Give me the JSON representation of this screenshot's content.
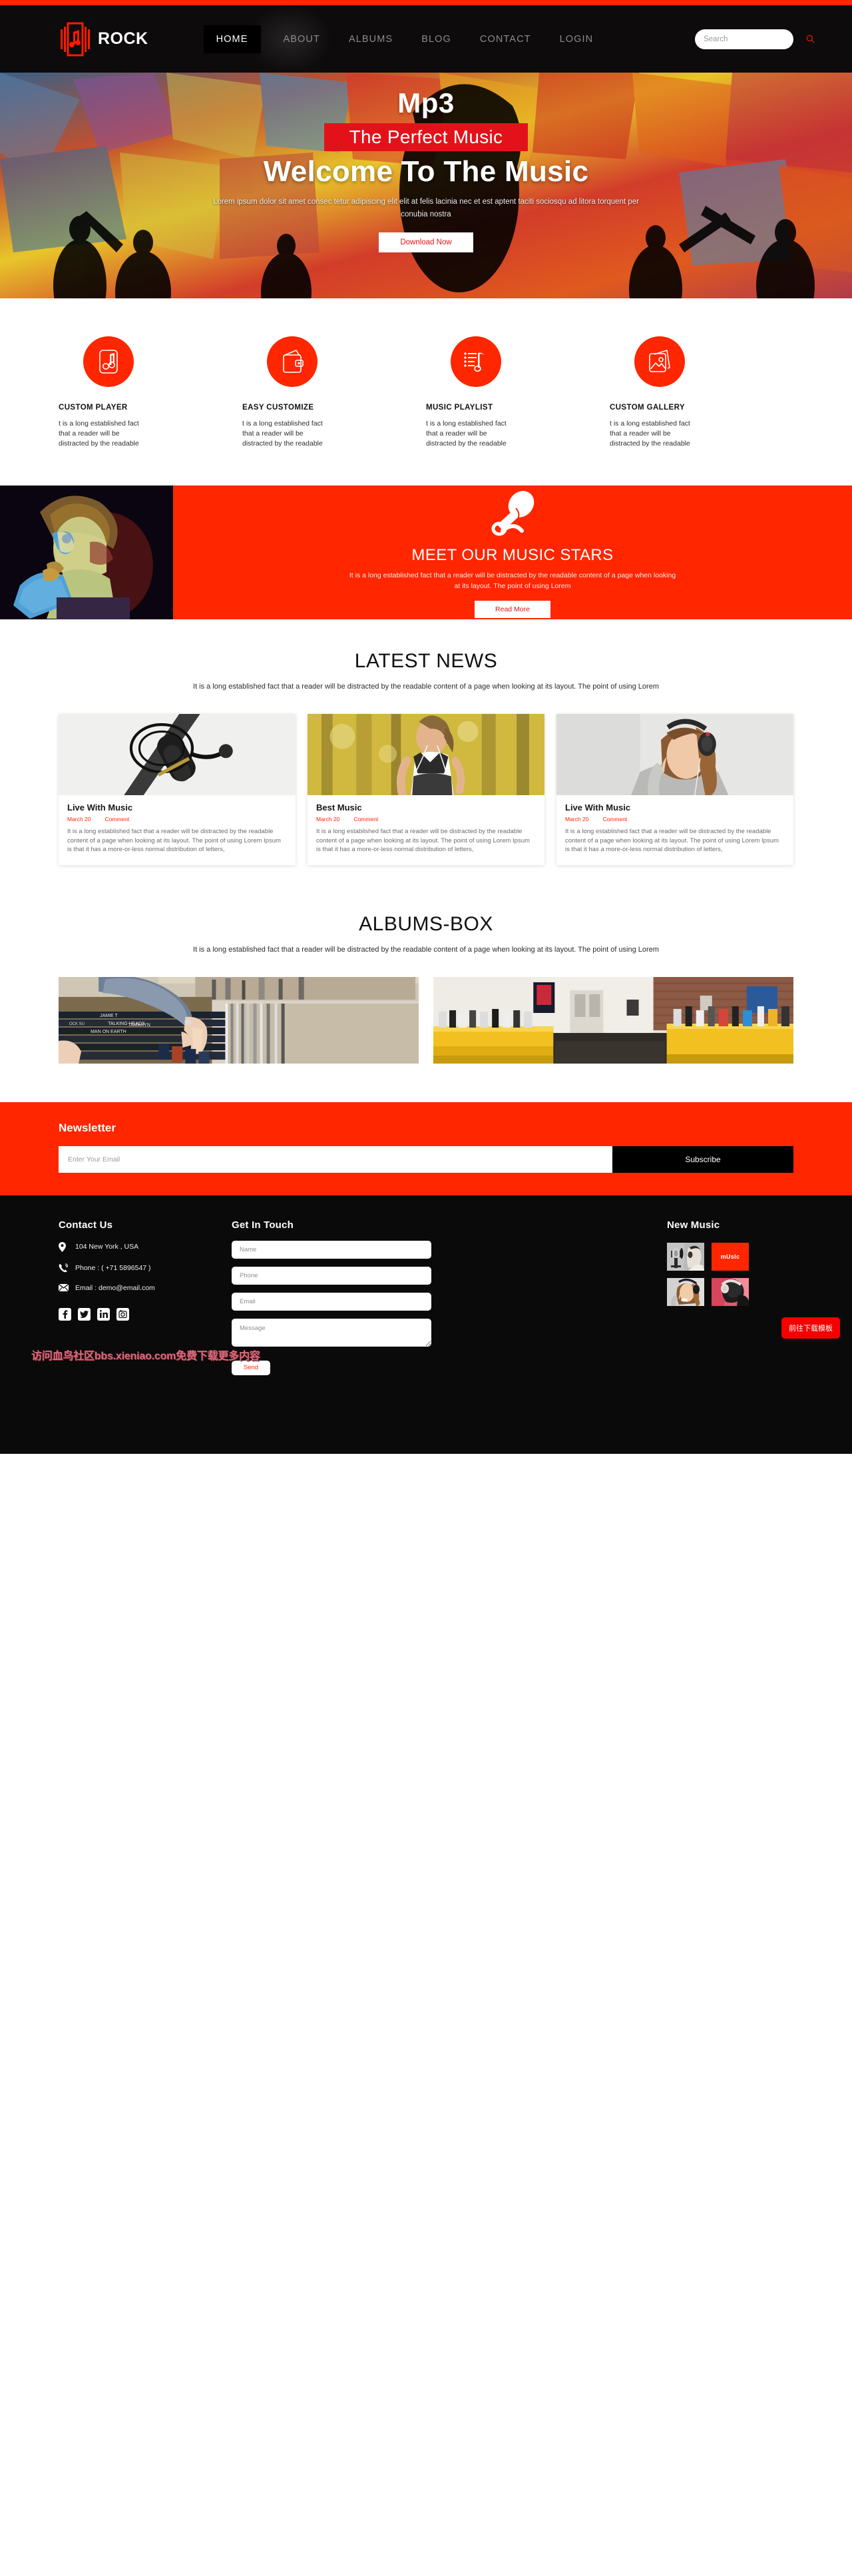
{
  "brand": {
    "name": "ROCK",
    "logo_icon": "music-note-logo-icon",
    "accent": "#ff2600"
  },
  "nav": {
    "items": [
      {
        "label": "HOME",
        "active": true
      },
      {
        "label": "ABOUT",
        "active": false
      },
      {
        "label": "ALBUMS",
        "active": false
      },
      {
        "label": "BLOG",
        "active": false
      },
      {
        "label": "CONTACT",
        "active": false
      },
      {
        "label": "LOGIN",
        "active": false
      }
    ]
  },
  "search": {
    "placeholder": "Search",
    "value": "",
    "icon": "search-icon"
  },
  "hero": {
    "eyebrow": "Mp3",
    "tagline": "The Perfect Music",
    "heading": "Welcome To The Music",
    "description": "Lorem ipsum dolor sit amet consec tetur adipiscing elit elit at felis lacinia nec et est aptent taciti sociosqu ad litora torquent per conubia nostra",
    "button_label": "Download Now"
  },
  "features": [
    {
      "icon": "music-player-icon",
      "title": "CUSTOM PLAYER",
      "text": "t is a long established fact that a reader will be distracted by the readable"
    },
    {
      "icon": "wallet-icon",
      "title": "EASY CUSTOMIZE",
      "text": "t is a long established fact that a reader will be distracted by the readable"
    },
    {
      "icon": "playlist-icon",
      "title": "MUSIC PLAYLIST",
      "text": "t is a long established fact that a reader will be distracted by the readable"
    },
    {
      "icon": "gallery-icon",
      "title": "CUSTOM GALLERY",
      "text": "t is a long established fact that a reader will be distracted by the readable"
    }
  ],
  "stars": {
    "icon": "microphone-icon",
    "title": "MEET OUR MUSIC STARS",
    "description": "It is a long established fact that a reader will be distracted by the readable content of a page when looking at its layout. The point of using Lorem",
    "button_label": "Read More"
  },
  "news": {
    "title": "LATEST NEWS",
    "subtitle": "It is a long established fact that a reader will be distracted by the readable content of a page when looking at its layout. The point of using Lorem",
    "cards": [
      {
        "image": "studio-microphone-photo",
        "title": "Live With Music",
        "date": "March 20",
        "comment": "Comment",
        "text": "It is a long established fact that a reader will be distracted by the readable content of a page when looking at its layout. The point of using Lorem Ipsum is that it has a more-or-less normal distribution of letters,"
      },
      {
        "image": "woman-jogging-with-earphones-photo",
        "title": "Best Music",
        "date": "March 20",
        "comment": "Comment",
        "text": "It is a long established fact that a reader will be distracted by the readable content of a page when looking at its layout. The point of using Lorem Ipsum is that it has a more-or-less normal distribution of letters,"
      },
      {
        "image": "woman-with-headphones-photo",
        "title": "Live With Music",
        "date": "March 20",
        "comment": "Comment",
        "text": "It is a long established fact that a reader will be distracted by the readable content of a page when looking at its layout. The point of using Lorem Ipsum is that it has a more-or-less normal distribution of letters,"
      }
    ]
  },
  "albums": {
    "title": "ALBUMS-BOX",
    "subtitle": "It is a long established fact that a reader will be distracted by the readable content of a page when looking at its layout. The point of using Lorem",
    "images": [
      {
        "name": "hands-browsing-vinyl-records-photo"
      },
      {
        "name": "record-store-aisle-photo"
      }
    ]
  },
  "newsletter": {
    "title": "Newsletter",
    "placeholder": "Enter Your Email",
    "value": "",
    "button_label": "Subscribe"
  },
  "footer": {
    "contact": {
      "heading": "Contact Us",
      "address": "104 New York , USA",
      "phone": "Phone : ( +71 5896547 )",
      "email": "Email : demo@email.com",
      "socials": [
        {
          "name": "facebook-icon"
        },
        {
          "name": "twitter-icon"
        },
        {
          "name": "linkedin-icon"
        },
        {
          "name": "instagram-icon"
        }
      ]
    },
    "form": {
      "heading": "Get In Touch",
      "name_placeholder": "Name",
      "phone_placeholder": "Phone",
      "email_placeholder": "Email",
      "message_placeholder": "Message",
      "send_label": "Send"
    },
    "new_music": {
      "heading": "New Music",
      "tiles": [
        {
          "type": "photo",
          "name": "child-singing-into-microphone-photo"
        },
        {
          "type": "label",
          "label": "mUsIc"
        },
        {
          "type": "photo",
          "name": "woman-with-headphones-photo"
        },
        {
          "type": "photo",
          "name": "headphones-on-pink-background-photo"
        }
      ]
    },
    "watermark": "访问血鸟社区bbs.xieniao.com免费下载更多内容",
    "download_button": "前往下载模板"
  }
}
